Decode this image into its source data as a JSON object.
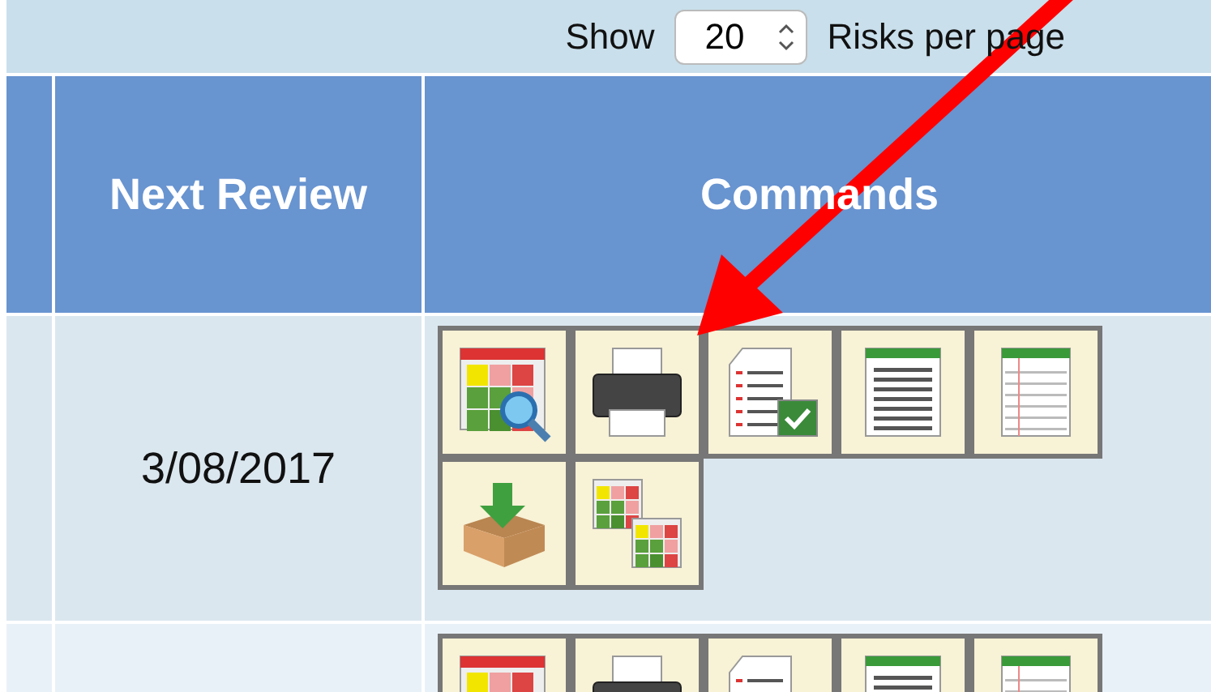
{
  "pager": {
    "label_before": "Show",
    "page_size": "20",
    "label_after": "Risks per page"
  },
  "table": {
    "columns": [
      "",
      "Next Review",
      "Commands"
    ],
    "rows": [
      {
        "next_review": "3/08/2017",
        "commands": [
          {
            "kind": "grid-search"
          },
          {
            "kind": "printer"
          },
          {
            "kind": "checklist"
          },
          {
            "kind": "text-document"
          },
          {
            "kind": "lined-page"
          },
          {
            "kind": "box-download"
          },
          {
            "kind": "two-grids"
          }
        ]
      },
      {
        "next_review": "",
        "commands": [
          {
            "kind": "grid-search"
          },
          {
            "kind": "printer"
          },
          {
            "kind": "checklist"
          },
          {
            "kind": "text-document"
          },
          {
            "kind": "lined-page"
          }
        ]
      }
    ]
  },
  "annotation": {
    "kind": "arrow"
  }
}
